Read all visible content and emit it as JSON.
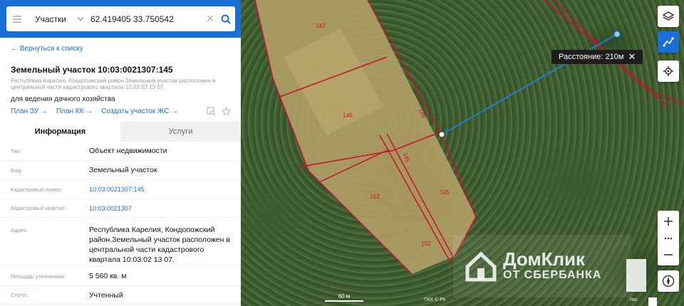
{
  "search": {
    "type_select": "Участки",
    "query": "62.419405 33.750542"
  },
  "panel": {
    "back_link": "← Вернуться к списку",
    "title": "Земельный участок 10:03:0021307:145",
    "address": "Республика Карелия, Кондопожский район.Земельный участок расположен в центральной части кадастрового квартала 10:03:02 13 07.",
    "usage": "для ведения дачного хозяйства",
    "links": [
      "План ЗУ →",
      "План КК →",
      "Создать участок ЖС →"
    ],
    "tabs": [
      "Информация",
      "Услуги"
    ],
    "rows": [
      {
        "k": "Тип:",
        "v": "Объект недвижимости"
      },
      {
        "k": "Вид:",
        "v": "Земельный участок"
      },
      {
        "k": "Кадастровый номер:",
        "v": "10:03:0021307:145"
      },
      {
        "k": "Кадастровый квартал:",
        "v": "10:03:0021307"
      },
      {
        "k": "Адрес:",
        "v": "Республика Карелия, Кондопожский район.Земельный участок расположен в центральной части кадастрового квартала 10:03:02 13 07."
      },
      {
        "k": "Площадь уточненная:",
        "v": "5 560 кв. м"
      },
      {
        "k": "Статус:",
        "v": "Учтенный"
      }
    ]
  },
  "map": {
    "distance_label": "Расстояние: 210м",
    "parcel_labels": [
      "147",
      "146",
      "148",
      "145",
      "152",
      "145",
      "152"
    ],
    "scale_label": "60 м",
    "copyright": "ПКК © Ро",
    "watermark_line1": "ДомКлик",
    "watermark_line2": "ОТ СБЕРБАНКА",
    "bottom_text": "пкс",
    "colors": {
      "parcel_border": "#c8102e",
      "measure_line": "#1f7ad8",
      "accent": "#1a6fd6"
    }
  }
}
